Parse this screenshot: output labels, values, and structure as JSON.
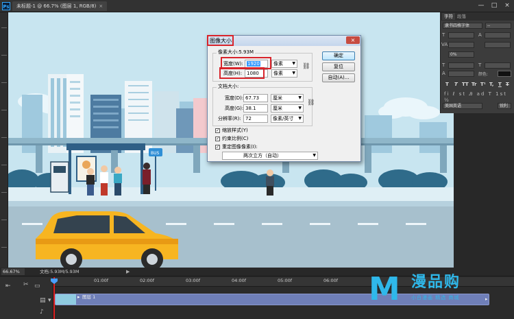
{
  "titlebar": {
    "app_logo": "Ps",
    "doc_tab_title": "未标题-1 @ 66.7% (图层 1, RGB/8)",
    "doc_tab_close": "×",
    "window_buttons": [
      "—",
      "□",
      "×"
    ]
  },
  "character_panel": {
    "tabs": [
      "字符",
      "段落"
    ],
    "font_family": "隶书四格字体",
    "font_style": "--",
    "size_label": "T",
    "leading_label": "A",
    "tracking_label": "VA",
    "percent": "0%",
    "color_label": "颜色:",
    "style_buttons": [
      "T",
      "T",
      "TT",
      "Tr",
      "T¹",
      "T,",
      "T",
      "T"
    ],
    "language": "美国英语",
    "aa": "锐利"
  },
  "dialog": {
    "title": "图像大小",
    "close": "×",
    "pixel_dims_label": "像素大小:5.93M",
    "width_label": "宽度(W):",
    "width_value": "1920",
    "width_unit": "像素",
    "height_label": "高度(H):",
    "height_value": "1080",
    "height_unit": "像素",
    "doc_size_label": "文档大小:",
    "doc_width_label": "宽度(D):",
    "doc_width_value": "67.73",
    "doc_width_unit": "厘米",
    "doc_height_label": "高度(G):",
    "doc_height_value": "38.1",
    "doc_height_unit": "厘米",
    "resolution_label": "分辨率(R):",
    "resolution_value": "72",
    "resolution_unit": "像素/英寸",
    "scale_styles": "缩放样式(Y)",
    "constrain": "约束比例(C)",
    "resample": "重定图像像素(I):",
    "resample_method": "两次立方（自动）",
    "ok": "确定",
    "reset": "复位",
    "auto": "自动(A)..."
  },
  "status": {
    "zoom": "66.67%",
    "doc_info": "文档:5.93M/5.93M"
  },
  "timeline": {
    "times": [
      "01:00f",
      "02:00f",
      "03:00f",
      "04:00f",
      "05:00f",
      "06:00f"
    ],
    "layer_label": "图层 1"
  },
  "watermark": {
    "letter": "M",
    "name": "漫品购",
    "slogan": "小白漫画 精选 商城"
  },
  "scene": {
    "bus_sign": "BUS"
  }
}
